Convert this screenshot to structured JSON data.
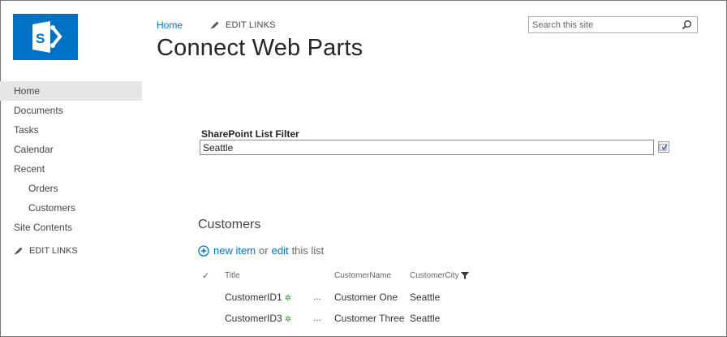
{
  "header": {
    "home_link": "Home",
    "edit_links": "EDIT LINKS",
    "page_title": "Connect Web Parts",
    "search_placeholder": "Search this site"
  },
  "leftnav": {
    "items": [
      {
        "label": "Home"
      },
      {
        "label": "Documents"
      },
      {
        "label": "Tasks"
      },
      {
        "label": "Calendar"
      },
      {
        "label": "Recent"
      },
      {
        "label": "Orders"
      },
      {
        "label": "Customers"
      },
      {
        "label": "Site Contents"
      }
    ],
    "edit_links": "EDIT LINKS"
  },
  "filter": {
    "title": "SharePoint List Filter",
    "value": "Seattle"
  },
  "list": {
    "title": "Customers",
    "new_item": "new item",
    "or": "or",
    "edit": "edit",
    "this_list": "this list",
    "columns": [
      "Title",
      "CustomerName",
      "CustomerCity"
    ],
    "rows": [
      {
        "title": "CustomerID1",
        "name": "Customer One",
        "city": "Seattle"
      },
      {
        "title": "CustomerID3",
        "name": "Customer Three",
        "city": "Seattle"
      }
    ],
    "ellipsis": "..."
  },
  "colors": {
    "link": "#0072c6",
    "brand": "#0072c6",
    "new_badge": "#2ca02c",
    "selected_nav": "#e6e6e6"
  }
}
